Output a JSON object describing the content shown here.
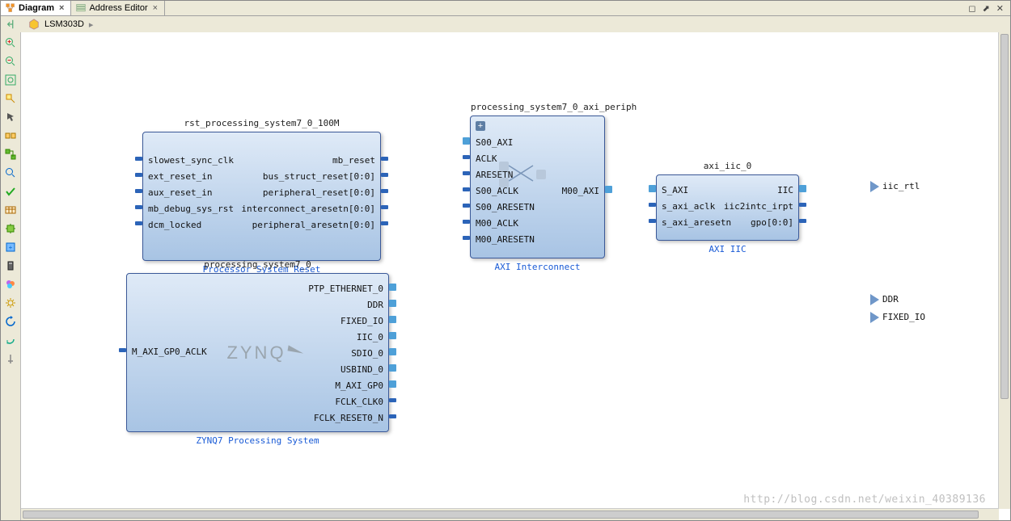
{
  "tabs": [
    {
      "label": "Diagram",
      "active": true
    },
    {
      "label": "Address Editor",
      "active": false
    }
  ],
  "breadcrumb": {
    "design": "LSM303D"
  },
  "toolbar_icons": [
    "zoom-in",
    "zoom-out",
    "zoom-fit",
    "zoom-area",
    "select",
    "auto-layout",
    "optimize-routing",
    "search",
    "validate",
    "regenerate-layout",
    "add-ip",
    "add-module",
    "palette",
    "settings",
    "refresh",
    "rotate",
    "pin-mode"
  ],
  "blocks": {
    "rst": {
      "instance": "rst_processing_system7_0_100M",
      "type": "Processor System Reset",
      "ports_left": [
        "slowest_sync_clk",
        "ext_reset_in",
        "aux_reset_in",
        "mb_debug_sys_rst",
        "dcm_locked"
      ],
      "ports_right": [
        "mb_reset",
        "bus_struct_reset[0:0]",
        "peripheral_reset[0:0]",
        "interconnect_aresetn[0:0]",
        "peripheral_aresetn[0:0]"
      ]
    },
    "ps7": {
      "instance": "processing_system7_0",
      "type": "ZYNQ7 Processing System",
      "logo_text": "ZYNQ",
      "ports_left": [
        "M_AXI_GP0_ACLK"
      ],
      "ports_right": [
        "PTP_ETHERNET_0",
        "DDR",
        "FIXED_IO",
        "IIC_0",
        "SDIO_0",
        "USBIND_0",
        "M_AXI_GP0",
        "FCLK_CLK0",
        "FCLK_RESET0_N"
      ]
    },
    "axi_ic": {
      "instance": "processing_system7_0_axi_periph",
      "type": "AXI Interconnect",
      "ports_left": [
        "S00_AXI",
        "ACLK",
        "ARESETN",
        "S00_ACLK",
        "S00_ARESETN",
        "M00_ACLK",
        "M00_ARESETN"
      ],
      "ports_right": [
        "M00_AXI"
      ]
    },
    "axi_iic": {
      "instance": "axi_iic_0",
      "type": "AXI IIC",
      "ports_left": [
        "S_AXI",
        "s_axi_aclk",
        "s_axi_aresetn"
      ],
      "ports_right": [
        "IIC",
        "iic2intc_irpt",
        "gpo[0:0]"
      ]
    }
  },
  "external_ports": [
    {
      "name": "iic_rtl",
      "kind": "interface"
    },
    {
      "name": "DDR",
      "kind": "interface"
    },
    {
      "name": "FIXED_IO",
      "kind": "interface"
    }
  ],
  "watermark": "http://blog.csdn.net/weixin_40389136"
}
